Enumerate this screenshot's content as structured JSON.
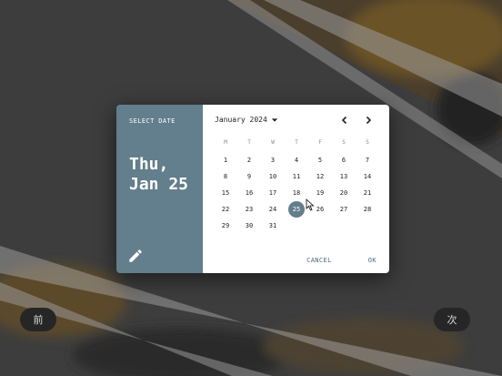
{
  "dialog": {
    "select_label": "SELECT DATE",
    "selected_weekday": "Thu,",
    "selected_date": "Jan 25",
    "month_label": "January 2024",
    "weekdays": [
      "M",
      "T",
      "W",
      "T",
      "F",
      "S",
      "S"
    ],
    "weeks": [
      [
        "1",
        "2",
        "3",
        "4",
        "5",
        "6",
        "7"
      ],
      [
        "8",
        "9",
        "10",
        "11",
        "12",
        "13",
        "14"
      ],
      [
        "15",
        "16",
        "17",
        "18",
        "19",
        "20",
        "21"
      ],
      [
        "22",
        "23",
        "24",
        "25",
        "26",
        "27",
        "28"
      ],
      [
        "29",
        "30",
        "31",
        "",
        "",
        "",
        ""
      ]
    ],
    "selected_day": "25",
    "cancel_label": "CANCEL",
    "ok_label": "OK",
    "icons": {
      "edit": "pencil-icon",
      "prev": "chevron-left-icon",
      "next": "chevron-right-icon",
      "month_dropdown": "caret-down-icon"
    },
    "accent_color": "#637e8c"
  },
  "pager": {
    "prev_label": "前",
    "next_label": "次"
  }
}
